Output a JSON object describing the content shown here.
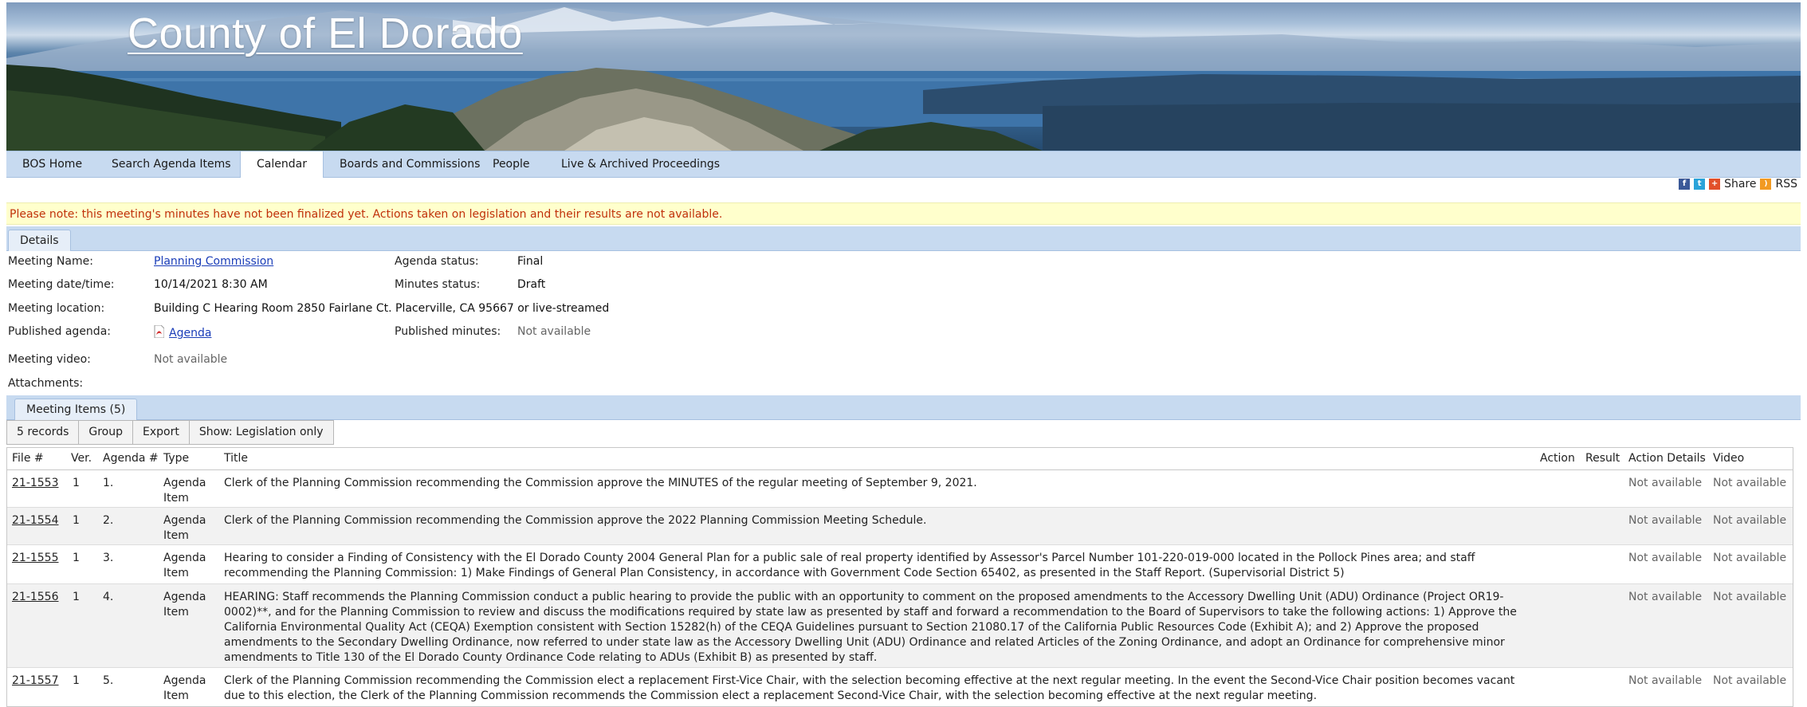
{
  "banner": {
    "title": "County of El Dorado"
  },
  "nav": {
    "items": [
      {
        "label": "BOS Home"
      },
      {
        "label": "Search Agenda Items"
      },
      {
        "label": "Calendar"
      },
      {
        "label": "Boards and Commissions"
      },
      {
        "label": "People"
      },
      {
        "label": "Live & Archived Proceedings"
      }
    ],
    "active": "Calendar"
  },
  "share_bar": {
    "share_label": "Share",
    "rss_label": "RSS"
  },
  "notice": "Please note: this meeting's minutes have not been finalized yet. Actions taken on legislation and their results are not available.",
  "details_tab": "Details",
  "details": {
    "meeting_name_label": "Meeting Name:",
    "meeting_name": "Planning Commission",
    "agenda_status_label": "Agenda status:",
    "agenda_status": "Final",
    "datetime_label": "Meeting date/time:",
    "datetime": "10/14/2021 8:30 AM",
    "minutes_status_label": "Minutes status:",
    "minutes_status": "Draft",
    "location_label": "Meeting location:",
    "location": "Building C Hearing Room 2850 Fairlane Ct. Placerville, CA 95667 or live-streamed",
    "published_agenda_label": "Published agenda:",
    "published_agenda": "Agenda",
    "published_minutes_label": "Published minutes:",
    "published_minutes": "Not available",
    "video_label": "Meeting video:",
    "video": "Not available",
    "attachments_label": "Attachments:"
  },
  "items_tab": "Meeting Items (5)",
  "toolbar": {
    "records": "5 records",
    "group": "Group",
    "export": "Export",
    "show": "Show: Legislation only"
  },
  "table": {
    "headers": {
      "file": "File #",
      "ver": "Ver.",
      "agenda": "Agenda #",
      "type": "Type",
      "title": "Title",
      "action": "Action",
      "result": "Result",
      "action_details": "Action Details",
      "video": "Video"
    },
    "rows": [
      {
        "file": "21-1553",
        "ver": "1",
        "agenda": "1.",
        "type_1": "Agenda",
        "type_2": "Item",
        "title": "Clerk of the Planning Commission recommending the Commission approve the MINUTES of the regular meeting of September 9, 2021.",
        "action_details": "Not available",
        "video": "Not available"
      },
      {
        "file": "21-1554",
        "ver": "1",
        "agenda": "2.",
        "type_1": "Agenda",
        "type_2": "Item",
        "title": "Clerk of the Planning Commission recommending the Commission approve the 2022 Planning Commission Meeting Schedule.",
        "action_details": "Not available",
        "video": "Not available"
      },
      {
        "file": "21-1555",
        "ver": "1",
        "agenda": "3.",
        "type_1": "Agenda",
        "type_2": "Item",
        "title": "Hearing to consider a Finding of Consistency with the El Dorado County 2004 General Plan for a public sale of real property identified by Assessor's Parcel Number 101-220-019-000 located in the Pollock Pines area; and staff recommending the Planning Commission: 1) Make Findings of General Plan Consistency, in accordance with Government Code Section 65402, as presented in the Staff Report. (Supervisorial District 5)",
        "action_details": "Not available",
        "video": "Not available"
      },
      {
        "file": "21-1556",
        "ver": "1",
        "agenda": "4.",
        "type_1": "Agenda",
        "type_2": "Item",
        "title": "HEARING: Staff recommends the Planning Commission conduct a public hearing to provide the public with an opportunity to comment on the proposed amendments to the Accessory Dwelling Unit (ADU) Ordinance (Project OR19-0002)**, and for the Planning Commission to review and discuss the modifications required by state law as presented by staff and forward a recommendation to the Board of Supervisors to take the following actions: 1) Approve the California Environmental Quality Act (CEQA) Exemption consistent with Section 15282(h) of the CEQA Guidelines pursuant to Section 21080.17 of the California Public Resources Code (Exhibit A); and 2) Approve the proposed amendments to the Secondary Dwelling Ordinance, now referred to under state law as the Accessory Dwelling Unit (ADU) Ordinance and related Articles of the Zoning Ordinance, and adopt an Ordinance for comprehensive minor amendments to Title 130 of the El Dorado County Ordinance Code relating to ADUs (Exhibit B) as presented by staff.",
        "action_details": "Not available",
        "video": "Not available"
      },
      {
        "file": "21-1557",
        "ver": "1",
        "agenda": "5.",
        "type_1": "Agenda",
        "type_2": "Item",
        "title": "Clerk of the Planning Commission recommending the Commission elect a replacement First-Vice Chair, with the selection becoming effective at the next regular meeting. In the event the Second-Vice Chair position becomes vacant due to this election, the Clerk of the Planning Commission recommends the Commission elect a replacement Second-Vice Chair, with the selection becoming effective at the next regular meeting.",
        "action_details": "Not available",
        "video": "Not available"
      }
    ]
  }
}
